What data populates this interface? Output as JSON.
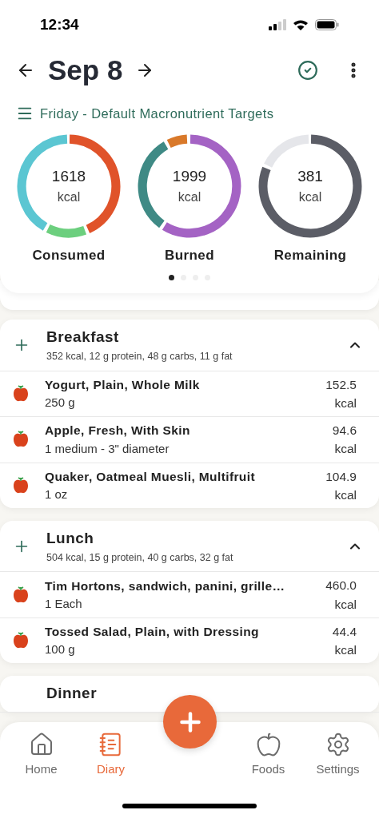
{
  "status_bar": {
    "time": "12:34"
  },
  "header": {
    "date": "Sep 8",
    "subtitle": "Friday - Default Macronutrient Targets"
  },
  "summary": {
    "rings": [
      {
        "kind": "consumed",
        "value": "1618",
        "unit": "kcal",
        "label": "Consumed"
      },
      {
        "kind": "burned",
        "value": "1999",
        "unit": "kcal",
        "label": "Burned"
      },
      {
        "kind": "remaining",
        "value": "381",
        "unit": "kcal",
        "label": "Remaining"
      }
    ],
    "pages": [
      {
        "selected": true
      },
      {
        "selected": false
      },
      {
        "selected": false
      },
      {
        "selected": false
      }
    ]
  },
  "meals": [
    {
      "name": "Breakfast",
      "summary": "352 kcal, 12 g protein, 48 g carbs, 11 g fat",
      "expanded": true,
      "items": [
        {
          "name": "Yogurt, Plain, Whole Milk",
          "amount": "250 g",
          "kcal": "152.5",
          "unit": "kcal"
        },
        {
          "name": "Apple, Fresh, With Skin",
          "amount": "1 medium - 3\" diameter",
          "kcal": "94.6",
          "unit": "kcal"
        },
        {
          "name": "Quaker, Oatmeal Muesli, Multifruit",
          "amount": "1 oz",
          "kcal": "104.9",
          "unit": "kcal"
        }
      ]
    },
    {
      "name": "Lunch",
      "summary": "504 kcal, 15 g protein, 40 g carbs, 32 g fat",
      "expanded": true,
      "items": [
        {
          "name": "Tim Hortons, sandwich, panini, grille…",
          "amount": "1 Each",
          "kcal": "460.0",
          "unit": "kcal"
        },
        {
          "name": "Tossed Salad, Plain, with Dressing",
          "amount": "100 g",
          "kcal": "44.4",
          "unit": "kcal"
        }
      ]
    },
    {
      "name": "Dinner"
    }
  ],
  "nav": [
    {
      "kind": "home",
      "label": "Home",
      "selected": false
    },
    {
      "kind": "diary",
      "label": "Diary",
      "selected": true
    },
    {
      "kind": "foods",
      "label": "Foods",
      "selected": false
    },
    {
      "kind": "settings",
      "label": "Settings",
      "selected": false
    }
  ]
}
